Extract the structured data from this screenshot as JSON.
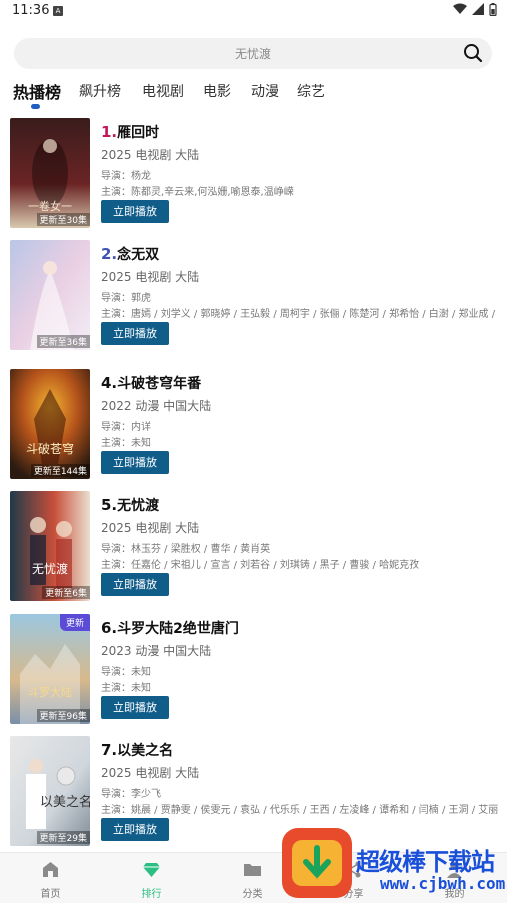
{
  "status_bar": {
    "time": "11:36",
    "notification_letter": "A"
  },
  "search": {
    "placeholder": "无忧渡"
  },
  "tabs": [
    {
      "label": "热播榜",
      "active": true
    },
    {
      "label": "飙升榜",
      "active": false
    },
    {
      "label": "电视剧",
      "active": false
    },
    {
      "label": "电影",
      "active": false
    },
    {
      "label": "动漫",
      "active": false
    },
    {
      "label": "综艺",
      "active": false
    }
  ],
  "items": [
    {
      "rank": "1.",
      "rank_color": "#c2185b",
      "title": "雁回时",
      "meta": "2025  电视剧  大陆",
      "director": "导演：杨龙",
      "cast": "主演：陈都灵,辛云来,何泓姗,喻恩泰,温峥嵘",
      "badge": "更新至30集",
      "button": "立即播放",
      "poster_colors": [
        "#3a1c1c",
        "#6b2424",
        "#d9c9b0"
      ],
      "poster_text": "一卷女一"
    },
    {
      "rank": "2.",
      "rank_color": "#3f51b5",
      "title": "念无双",
      "meta": "2025  电视剧  大陆",
      "director": "导演：郭虎",
      "cast": "主演：唐嫣 / 刘学义 / 郭晓婷 / 王弘毅 / 周柯宇 / 张俪 / 陈楚河 / 郑希怡 / 白澍 / 郑业成 / ...",
      "badge": "更新至36集",
      "button": "立即播放",
      "poster_colors": [
        "#b9c6e6",
        "#e9cfe3",
        "#f3eef6"
      ],
      "poster_text": ""
    },
    {
      "rank": "4.",
      "rank_color": "#111111",
      "title": "斗破苍穹年番",
      "meta": "2022  动漫  中国大陆",
      "director": "导演：内详",
      "cast": "主演：未知",
      "badge": "更新至144集",
      "button": "立即播放",
      "poster_colors": [
        "#2a1a10",
        "#b4531b",
        "#f5b531"
      ],
      "poster_text": "斗破苍穹"
    },
    {
      "rank": "5.",
      "rank_color": "#111111",
      "title": "无忧渡",
      "meta": "2025  电视剧  大陆",
      "director": "导演：林玉芬 / 梁胜权 / 曹华 / 黄肖英",
      "cast": "主演：任嘉伦 / 宋祖儿 / 宣言 / 刘若谷 / 刘琪铸 / 黑子 / 曹骏 / 哈妮克孜",
      "badge": "更新至6集",
      "button": "立即播放",
      "poster_colors": [
        "#1f3a4a",
        "#c84f3a",
        "#eadfcf"
      ],
      "poster_text": "无忧渡"
    },
    {
      "rank": "6.",
      "rank_color": "#111111",
      "title": "斗罗大陆2绝世唐门",
      "meta": "2023  动漫  中国大陆",
      "director": "导演：未知",
      "cast": "主演：未知",
      "badge": "更新至96集",
      "update_tag": "更新",
      "button": "立即播放",
      "poster_colors": [
        "#9bc7e0",
        "#d7b98c",
        "#7a8fa8"
      ],
      "poster_text": "斗罗大陆"
    },
    {
      "rank": "7.",
      "rank_color": "#111111",
      "title": "以美之名",
      "meta": "2025  电视剧  大陆",
      "director": "导演：李少飞",
      "cast": "主演：姚晨 / 贾静雯 / 侯雯元 / 袁弘 / 代乐乐 / 王西 / 左凌峰 / 谭希和 / 闫楠 / 王洞 / 艾丽...",
      "badge": "更新至29集",
      "button": "立即播放",
      "poster_colors": [
        "#e8e8e8",
        "#cfd6dc",
        "#7e8a95"
      ],
      "poster_text": "以美之名"
    }
  ],
  "bottom_nav": [
    {
      "label": "首页",
      "icon": "home-icon",
      "active": false
    },
    {
      "label": "排行",
      "icon": "diamond-icon",
      "active": true
    },
    {
      "label": "分类",
      "icon": "folder-icon",
      "active": false
    },
    {
      "label": "分享",
      "icon": "share-icon",
      "active": false
    },
    {
      "label": "我的",
      "icon": "user-icon",
      "active": false
    }
  ],
  "watermark": {
    "name": "超级棒下载站",
    "url": "www.cjbwh.com"
  }
}
